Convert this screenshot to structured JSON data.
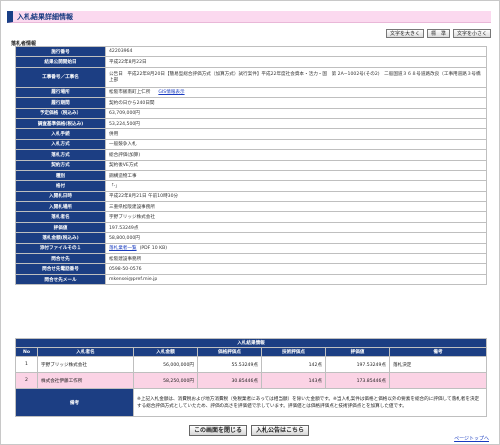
{
  "page_title": "入札結果詳細情報",
  "text_size": {
    "large": "文字を大きく",
    "standard": "標　準",
    "small": "文字を小さく"
  },
  "section_label": "落札者情報",
  "info_rows": [
    {
      "label": "施行番号",
      "value": "42203964"
    },
    {
      "label": "結果公開開始日",
      "value": "平成22年8月22日"
    },
    {
      "label": "工事番号／工事名",
      "value": "公告日　平成22年8月20日【簡易型総合評価方式（加算方式）試行案件】平成22年度社会資本・活力・国　第 2A−1002号(その2)　二般国道３６８号道路改良（工事用道路３号橋上部"
    },
    {
      "label": "履行場所",
      "value": "松阪市飯南町上仁所",
      "link": "GIS情報表示"
    },
    {
      "label": "履行期間",
      "value": "契約の日から240日間"
    },
    {
      "label": "予定価格（税込み）",
      "value": "63,709,000円"
    },
    {
      "label": "調査基準価格(税込み)",
      "value": "53,224,500円"
    },
    {
      "label": "入札手続",
      "value": "併用"
    },
    {
      "label": "入札方式",
      "value": "一般競争入札"
    },
    {
      "label": "落札方式",
      "value": "総合評価(加算)"
    },
    {
      "label": "契約方式",
      "value": "契約後VE方式"
    },
    {
      "label": "種別",
      "value": "鋼構造物工事"
    },
    {
      "label": "格付",
      "value": "「-」"
    },
    {
      "label": "入開札日時",
      "value": "平成22年8月21日 午前10時30分"
    },
    {
      "label": "入開札場所",
      "value": "三重県松阪建設事務所"
    },
    {
      "label": "落札者名",
      "value": "宇野ブリッジ株式会社"
    },
    {
      "label": "評価値",
      "value": "197.53249点"
    },
    {
      "label": "落札金額(税込み)",
      "value": "58,800,000円"
    },
    {
      "label": "添付ファイルその１",
      "value": "(PDF 10 KB)",
      "link": "落札業者一覧"
    },
    {
      "label": "問合せ先",
      "value": "松阪建設事務所"
    },
    {
      "label": "問合せ先電話番号",
      "value": "0598-50-0576"
    },
    {
      "label": "問合せ先メール",
      "value": "mkensei@pref.mie.jp"
    }
  ],
  "results": {
    "caption": "入札結果情報",
    "headers": [
      "No",
      "入札者名",
      "入札金額",
      "価格評価点",
      "技術評価点",
      "評価値",
      "備考"
    ],
    "rows": [
      {
        "no": "1",
        "name": "宇野ブリッジ株式会社",
        "amount": "56,000,000円",
        "price_score": "55.53249点",
        "tech_score": "142点",
        "eval": "197.53249点",
        "remark": "落札決定"
      },
      {
        "no": "2",
        "name": "株式会社伊藤工作所",
        "amount": "58,250,000円",
        "price_score": "30.85446点",
        "tech_score": "143点",
        "eval": "173.85446点",
        "remark": ""
      }
    ],
    "note_label": "備考",
    "note_text": "※上記入札金額は、消費税および地方消費税（免税業者にあっては相当額）を除いた金額です。※当入札案件は価格と価格以外の要素を総合的に評価して落札者を決定する総合評価方式としていたため、評価の高さを評価値で示しています。評価値とは価格評価点と技術評価点とを加算した値です。"
  },
  "buttons": {
    "close": "この画面を閉じる",
    "notice": "入札公告はこちら"
  },
  "page_top": "ページトップへ"
}
